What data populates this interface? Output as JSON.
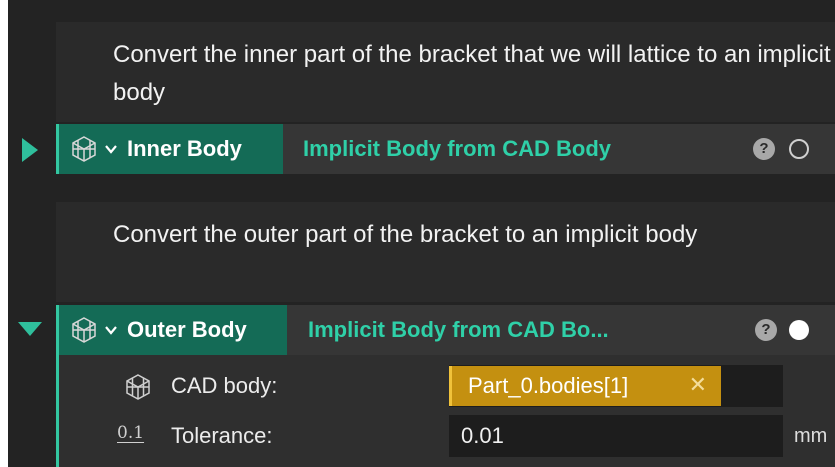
{
  "colors": {
    "accent": "#2fbf9c",
    "chip_bg": "#c49010",
    "panel_bg": "#232323"
  },
  "blocks": [
    {
      "comment": "Convert the inner part of the bracket that we will lattice to an implicit body",
      "name": "Inner Body",
      "type": "Implicit Body from CAD Body",
      "expanded": false,
      "help_label": "?",
      "icon": "lattice-block-icon"
    },
    {
      "comment": "Convert the outer part of the bracket to an implicit body",
      "name": "Outer Body",
      "type": "Implicit Body from CAD Bo...",
      "expanded": true,
      "help_label": "?",
      "icon": "lattice-block-icon",
      "params": {
        "cad_body": {
          "label": "CAD body:",
          "value": "Part_0.bodies[1]",
          "clear": "✕",
          "icon": "cube-icon"
        },
        "tolerance": {
          "label": "Tolerance:",
          "value": "0.01",
          "unit": "mm",
          "icon_text": "0.1"
        }
      }
    }
  ]
}
